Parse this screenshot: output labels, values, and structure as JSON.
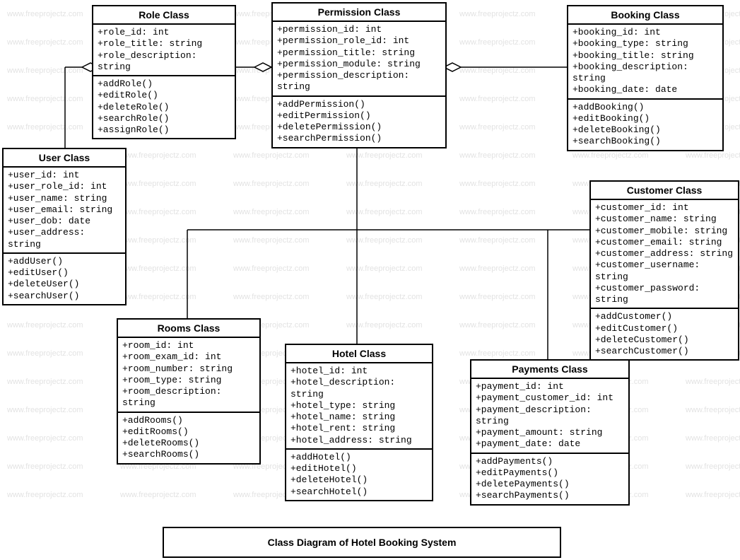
{
  "watermark_text": "www.freeprojectz.com",
  "diagram_title": "Class Diagram of Hotel Booking System",
  "classes": {
    "role": {
      "title": "Role Class",
      "attrs": [
        "+role_id: int",
        "+role_title: string",
        "+role_description: string"
      ],
      "methods": [
        "+addRole()",
        "+editRole()",
        "+deleteRole()",
        "+searchRole()",
        "+assignRole()"
      ]
    },
    "permission": {
      "title": "Permission Class",
      "attrs": [
        "+permission_id: int",
        "+permission_role_id: int",
        "+permission_title: string",
        "+permission_module: string",
        "+permission_description: string"
      ],
      "methods": [
        "+addPermission()",
        "+editPermission()",
        "+deletePermission()",
        "+searchPermission()"
      ]
    },
    "booking": {
      "title": "Booking Class",
      "attrs": [
        "+booking_id: int",
        "+booking_type: string",
        "+booking_title: string",
        "+booking_description: string",
        "+booking_date: date"
      ],
      "methods": [
        "+addBooking()",
        "+editBooking()",
        "+deleteBooking()",
        "+searchBooking()"
      ]
    },
    "user": {
      "title": "User Class",
      "attrs": [
        "+user_id: int",
        "+user_role_id: int",
        "+user_name: string",
        "+user_email: string",
        "+user_dob: date",
        "+user_address: string"
      ],
      "methods": [
        "+addUser()",
        "+editUser()",
        "+deleteUser()",
        "+searchUser()"
      ]
    },
    "customer": {
      "title": "Customer Class",
      "attrs": [
        "+customer_id: int",
        "+customer_name: string",
        "+customer_mobile: string",
        "+customer_email: string",
        "+customer_address: string",
        "+customer_username: string",
        "+customer_password: string"
      ],
      "methods": [
        "+addCustomer()",
        "+editCustomer()",
        "+deleteCustomer()",
        "+searchCustomer()"
      ]
    },
    "rooms": {
      "title": "Rooms Class",
      "attrs": [
        "+room_id: int",
        "+room_exam_id: int",
        "+room_number: string",
        "+room_type: string",
        "+room_description: string"
      ],
      "methods": [
        "+addRooms()",
        "+editRooms()",
        "+deleteRooms()",
        "+searchRooms()"
      ]
    },
    "hotel": {
      "title": "Hotel Class",
      "attrs": [
        "+hotel_id: int",
        "+hotel_description: string",
        "+hotel_type: string",
        "+hotel_name: string",
        "+hotel_rent: string",
        "+hotel_address: string"
      ],
      "methods": [
        "+addHotel()",
        "+editHotel()",
        "+deleteHotel()",
        "+searchHotel()"
      ]
    },
    "payments": {
      "title": "Payments Class",
      "attrs": [
        "+payment_id: int",
        "+payment_customer_id: int",
        "+payment_description: string",
        "+payment_amount: string",
        "+payment_date: date"
      ],
      "methods": [
        "+addPayments()",
        "+editPayments()",
        "+deletePayments()",
        "+searchPayments()"
      ]
    }
  }
}
